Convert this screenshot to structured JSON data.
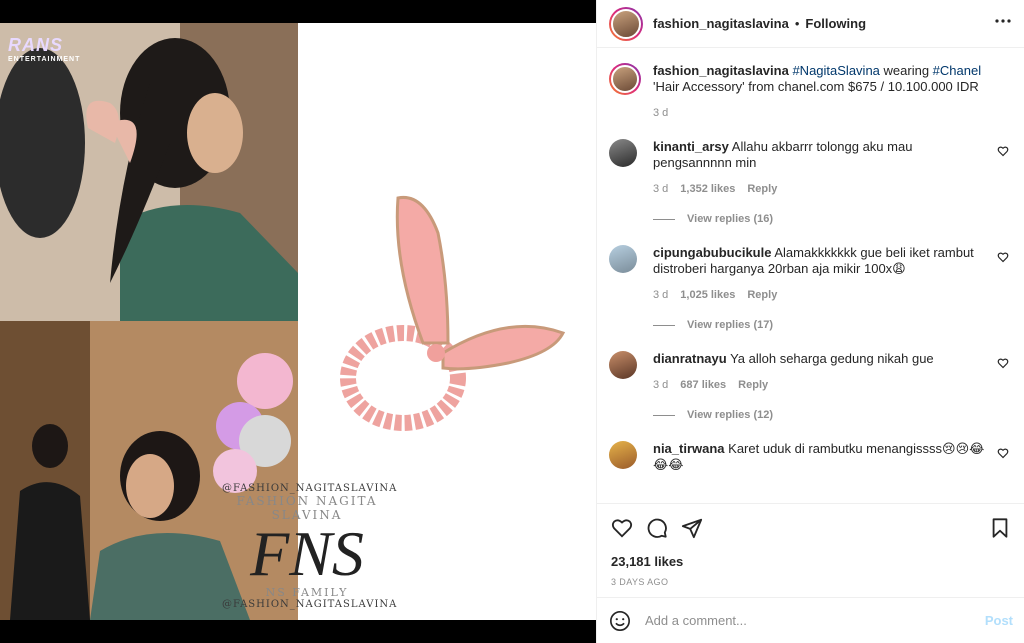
{
  "media": {
    "brand_big": "RANS",
    "brand_small": "ENTERTAINMENT",
    "watermark_handle": "@FASHION_NAGITASLAVINA",
    "watermark_name": "FASHION NAGITA SLAVINA",
    "watermark_logo": "FNS",
    "watermark_family": "NS FAMILY",
    "watermark_handle2": "@FASHION_NAGITASLAVINA"
  },
  "header": {
    "username": "fashion_nagitaslavina",
    "dot": "•",
    "follow_label": "Following",
    "more_icon": "more-horizontal-icon"
  },
  "caption": {
    "username": "fashion_nagitaslavina",
    "tag1": "#NagitaSlavina",
    "mid": " wearing ",
    "tag2": "#Chanel",
    "rest": " 'Hair Accessory' from chanel.com $675 / 10.100.000 IDR",
    "time": "3 d"
  },
  "comments": [
    {
      "username": "kinanti_arsy",
      "text": "Allahu akbarrr tolongg aku mau pengsannnnn min",
      "time": "3 d",
      "likes": "1,352 likes",
      "reply": "Reply",
      "view_replies": "View replies (16)"
    },
    {
      "username": "cipungabubucikule",
      "text": "Alamakkkkkkk gue beli iket rambut distroberi harganya 20rban aja mikir 100x😩",
      "time": "3 d",
      "likes": "1,025 likes",
      "reply": "Reply",
      "view_replies": "View replies (17)"
    },
    {
      "username": "dianratnayu",
      "text": "Ya alloh seharga gedung nikah gue",
      "time": "3 d",
      "likes": "687 likes",
      "reply": "Reply",
      "view_replies": "View replies (12)"
    },
    {
      "username": "nia_tirwana",
      "text": "Karet uduk di rambutku menangissss😢😢😂😂😂",
      "time": "",
      "likes": "",
      "reply": "",
      "view_replies": ""
    }
  ],
  "actions": {
    "like_icon": "heart-icon",
    "comment_icon": "comment-icon",
    "share_icon": "share-icon",
    "save_icon": "bookmark-icon",
    "likes": "23,181 likes",
    "posted": "3 DAYS AGO"
  },
  "add_comment": {
    "emoji_icon": "emoji-icon",
    "placeholder": "Add a comment...",
    "post_label": "Post"
  },
  "colors": {
    "link": "#00376b",
    "muted": "#8e8e8e",
    "post_disabled": "#b2dffc",
    "scrunchie": "#f0a3a0"
  }
}
